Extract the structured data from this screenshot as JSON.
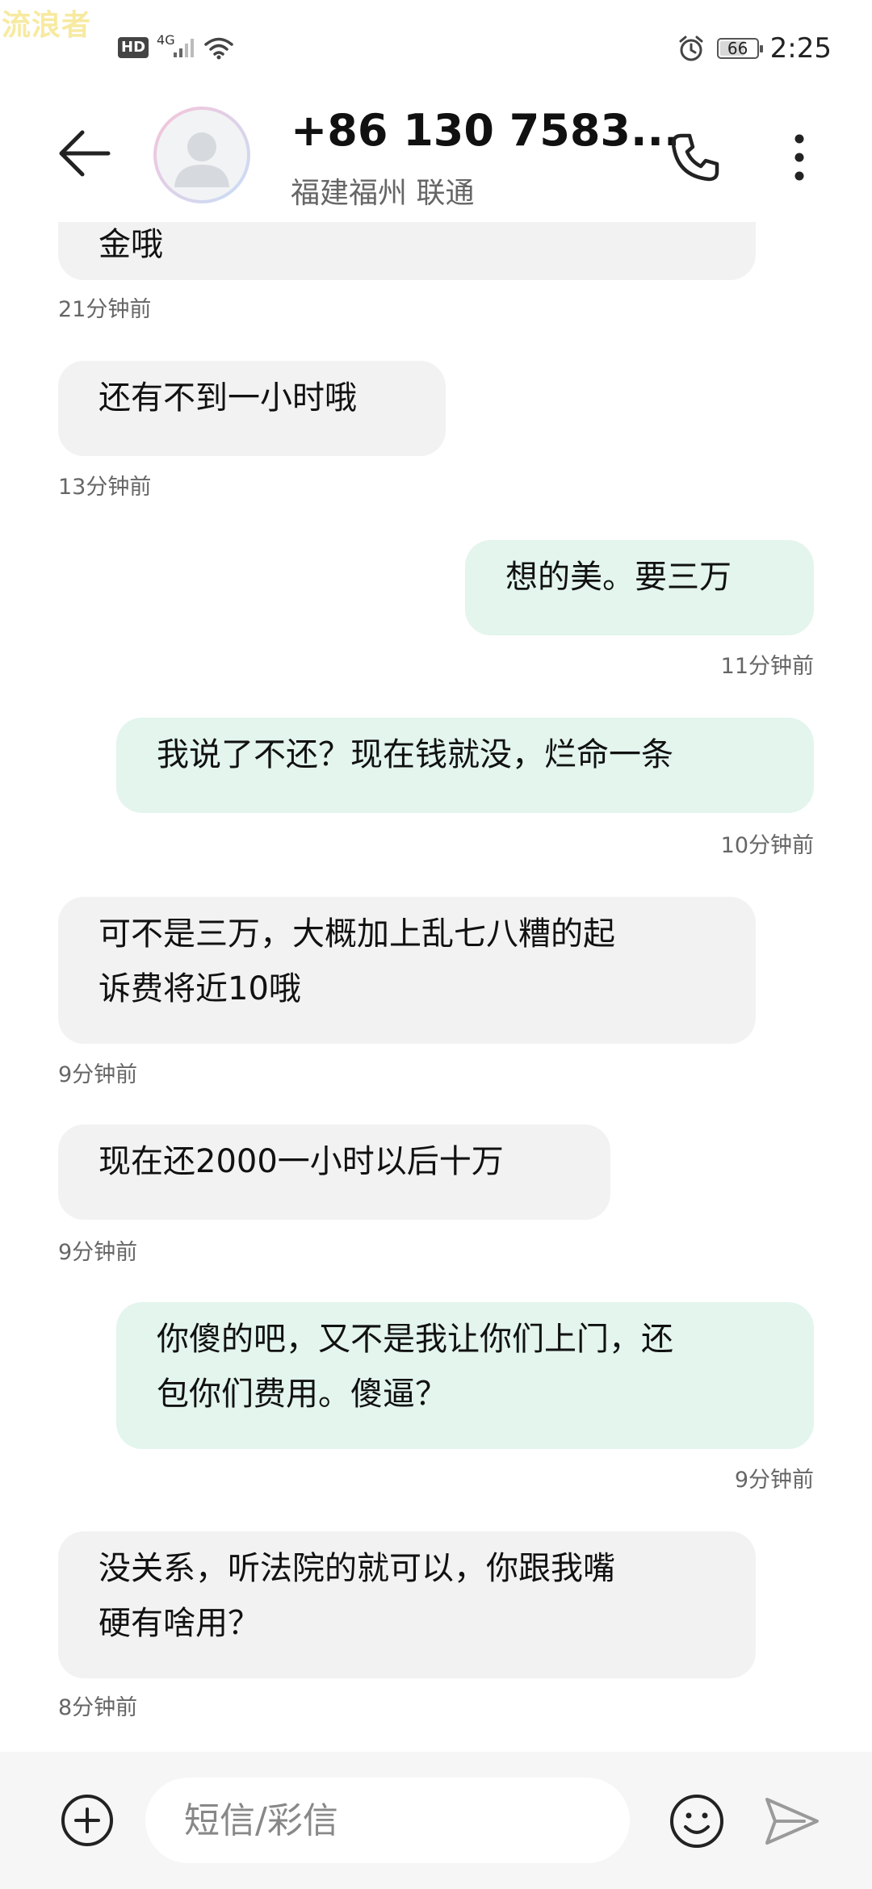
{
  "watermark": "流浪者",
  "status_bar": {
    "hd_badge": "HD",
    "network_type": "4G",
    "battery_level": "66",
    "time": "2:25",
    "icons": [
      "signal-icon",
      "wifi-icon",
      "alarm-icon",
      "battery-icon"
    ]
  },
  "header": {
    "contact_name": "+86 130 7583...",
    "contact_location": "福建福州 联通",
    "icons": [
      "back-arrow-icon",
      "avatar-icon",
      "phone-icon",
      "more-vertical-icon"
    ]
  },
  "messages": [
    {
      "direction": "incoming",
      "text": [
        "金哦"
      ],
      "time": "21分钟前"
    },
    {
      "direction": "incoming",
      "text": [
        "还有不到一小时哦"
      ],
      "time": "13分钟前"
    },
    {
      "direction": "outgoing",
      "text": [
        "想的美。要三万"
      ],
      "time": "11分钟前"
    },
    {
      "direction": "outgoing",
      "text": [
        "我说了不还？现在钱就没，烂命一条"
      ],
      "time": "10分钟前"
    },
    {
      "direction": "incoming",
      "text": [
        "可不是三万，大概加上乱七八糟的起",
        "诉费将近10哦"
      ],
      "time": "9分钟前"
    },
    {
      "direction": "incoming",
      "text": [
        "现在还2000一小时以后十万"
      ],
      "time": "9分钟前"
    },
    {
      "direction": "outgoing",
      "text": [
        "你傻的吧，又不是我让你们上门，还",
        "包你们费用。傻逼？"
      ],
      "time": "9分钟前"
    },
    {
      "direction": "incoming",
      "text": [
        "没关系，听法院的就可以，你跟我嘴",
        "硬有啥用？"
      ],
      "time": "8分钟前"
    }
  ],
  "input_bar": {
    "placeholder": "短信/彩信",
    "value": "",
    "icons": [
      "add-circle-icon",
      "emoji-icon",
      "send-icon"
    ]
  },
  "colors": {
    "incoming_bubble": "#f2f2f2",
    "outgoing_bubble": "#e3f5ed",
    "timestamp": "#666666",
    "input_bar_bg": "#f6f6f6"
  }
}
